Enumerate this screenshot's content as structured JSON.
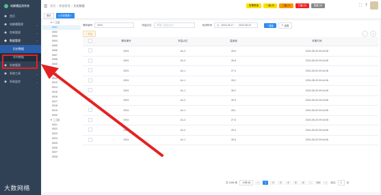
{
  "app": {
    "title": "电解槽监测系统"
  },
  "sidebar": {
    "items": [
      {
        "label": "首页",
        "icon": "home-icon"
      },
      {
        "label": "电解槽管理",
        "icon": "cell-icon",
        "chev": "⌄"
      },
      {
        "label": "控制管理",
        "icon": "control-icon",
        "chev": "⌄"
      },
      {
        "label": "数据管理",
        "icon": "data-icon",
        "chev": "⌃"
      },
      {
        "label": "历史数据",
        "icon": "history-icon",
        "sub": true,
        "active": true
      },
      {
        "label": "实时数据",
        "icon": "realtime-icon",
        "sub": true
      },
      {
        "label": "系统管理",
        "icon": "gear-icon",
        "chev": "⌄"
      },
      {
        "label": "系统工具",
        "icon": "tool-icon",
        "chev": "⌄"
      },
      {
        "label": "系统监控",
        "icon": "monitor-icon",
        "chev": "⌄"
      }
    ],
    "watermark": "大数网络"
  },
  "header": {
    "breadcrumb": [
      "首页",
      "数据管理",
      "历史数据"
    ],
    "badges": [
      {
        "label": "告警数量",
        "color": "#ffe000"
      },
      {
        "label": "一级 (0)",
        "color": "#ffe000"
      },
      {
        "label": "二级 (1)",
        "color": "#ff9900"
      },
      {
        "label": "三级 (2)",
        "color": "#ee2222"
      },
      {
        "label": "四级 (3)",
        "color": "#888888"
      }
    ]
  },
  "tags": [
    {
      "label": "首页",
      "active": false
    },
    {
      "label": "● 历史数据 ×",
      "active": true
    }
  ],
  "tree": [
    {
      "label": "一工区",
      "group": true
    },
    {
      "label": "0001",
      "sel": true
    },
    {
      "label": "0002"
    },
    {
      "label": "0003"
    },
    {
      "label": "0004"
    },
    {
      "label": "0005"
    },
    {
      "label": "0006"
    },
    {
      "label": "0007"
    },
    {
      "label": "0008"
    },
    {
      "label": "0009"
    },
    {
      "label": "0010"
    },
    {
      "label": "0011"
    },
    {
      "label": "0012"
    },
    {
      "label": "0013"
    },
    {
      "label": "0014"
    },
    {
      "label": "0015"
    },
    {
      "label": "0016"
    },
    {
      "label": "0017"
    },
    {
      "label": "0018"
    },
    {
      "label": "0019"
    },
    {
      "label": "0020"
    },
    {
      "label": "二工区",
      "group": true
    },
    {
      "label": "0021"
    },
    {
      "label": "0022"
    },
    {
      "label": "0023"
    },
    {
      "label": "0024"
    },
    {
      "label": "0025"
    },
    {
      "label": "0026"
    },
    {
      "label": "0027"
    },
    {
      "label": "0028"
    }
  ],
  "filters": {
    "cell_label": "槽体编号",
    "cell_value": "0001",
    "point_label": "测温点位",
    "point_placeholder": "请输入测温点位",
    "time_label": "检测时间",
    "date_start": "2024-05-17",
    "date_sep": "-",
    "date_end": "2024-05-22",
    "search": "搜索",
    "reset": "重置"
  },
  "toolbar": {
    "export": "导出"
  },
  "table": {
    "headers": [
      "槽体编号",
      "测温点位",
      "温度值",
      "采集时间"
    ],
    "rows": [
      [
        "0001",
        "A1-2",
        "26.6",
        "2024-05-20 09:44:06"
      ],
      [
        "0001",
        "A1-2",
        "26.6",
        "2024-05-20 09:44:06"
      ],
      [
        "0001",
        "A1-1",
        "27.4",
        "2024-05-20 09:44:06"
      ],
      [
        "0001",
        "A1-1",
        "26.2",
        "2024-05-20 09:44:06"
      ],
      [
        "0001",
        "A1-1",
        "28.2",
        "2024-05-20 09:44:06"
      ],
      [
        "0001",
        "A1-2",
        "26.3",
        "2024-05-20 09:44:06"
      ],
      [
        "0001",
        "A1-1",
        "28.1",
        "2024-05-20 09:44:06"
      ],
      [
        "0001",
        "A1-2",
        "27.6",
        "2024-05-20 09:44:06"
      ],
      [
        "0001",
        "A1-2",
        "25.4",
        "2024-05-20 09:44:06"
      ],
      [
        "0001",
        "A1-1",
        "26.6",
        "2024-05-20 09:44:06"
      ]
    ]
  },
  "pager": {
    "total": "共 2486 条",
    "page_size": "10条/页",
    "pages": [
      "1",
      "2",
      "3",
      "4",
      "5",
      "6",
      "...",
      "249"
    ],
    "goto": "前往",
    "goto_value": "1",
    "unit": "页"
  }
}
